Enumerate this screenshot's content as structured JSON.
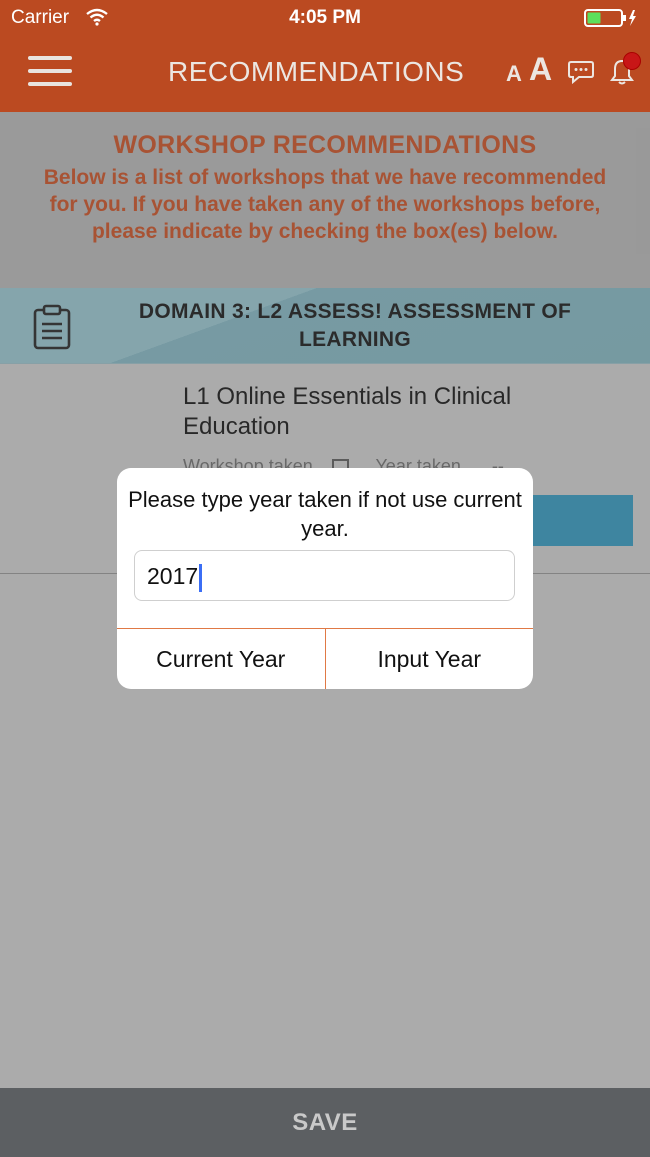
{
  "status_bar": {
    "carrier": "Carrier",
    "time": "4:05 PM"
  },
  "nav": {
    "title": "RECOMMENDATIONS",
    "font_small": "A",
    "font_large": "A",
    "icons": [
      "menu-icon",
      "chat-icon",
      "bell-icon"
    ]
  },
  "intro": {
    "title": "WORKSHOP RECOMMENDATIONS",
    "description": "Below is a list of workshops that we have recommended for you. If you have taken any of the workshops before, please indicate by checking the box(es) below."
  },
  "domain": {
    "title": "DOMAIN 3: L2 ASSESS! ASSESSMENT OF LEARNING"
  },
  "workshop": {
    "title": "L1 Online Essentials in Clinical Education",
    "taken_label": "Workshop taken",
    "year_label": "Year taken",
    "year_value": "--"
  },
  "dialog": {
    "message": "Please type year taken if not use current year.",
    "input_value": "2017",
    "buttons": [
      "Current Year",
      "Input Year"
    ]
  },
  "footer": {
    "save_label": "SAVE"
  },
  "colors": {
    "brand": "#bb4a21",
    "domain_band": "#8db7c1",
    "save_bar": "#5c5f62",
    "accent_blue": "#2e8db0"
  }
}
